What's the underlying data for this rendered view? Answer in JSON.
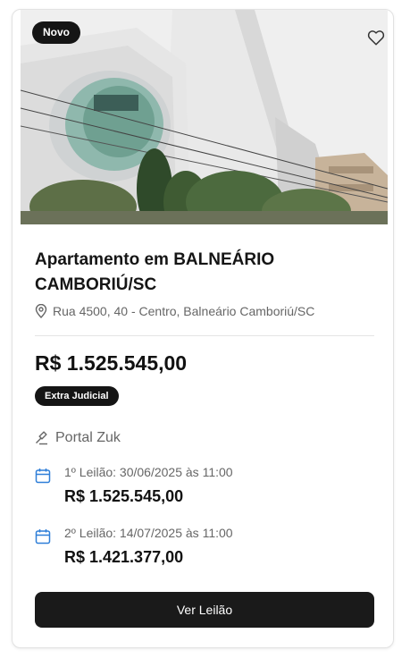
{
  "badge": "Novo",
  "title": "Apartamento em BALNEÁRIO CAMBORIÚ/SC",
  "address": "Rua 4500, 40 - Centro, Balneário Camboriú/SC",
  "price": "R$ 1.525.545,00",
  "sale_type": "Extra Judicial",
  "auctioneer": "Portal Zuk",
  "auctions": [
    {
      "label": "1º Leilão: 30/06/2025 às 11:00",
      "value": "R$ 1.525.545,00"
    },
    {
      "label": "2º Leilão: 14/07/2025 às 11:00",
      "value": "R$ 1.421.377,00"
    }
  ],
  "button_label": "Ver Leilão",
  "icons": {
    "favorite": "heart-icon",
    "address": "map-pin-icon",
    "auctioneer": "gavel-icon",
    "date": "calendar-icon"
  },
  "colors": {
    "calendar_icon": "#2f7fd8",
    "badge_bg": "#151515",
    "button_bg": "#1a1a1a"
  }
}
